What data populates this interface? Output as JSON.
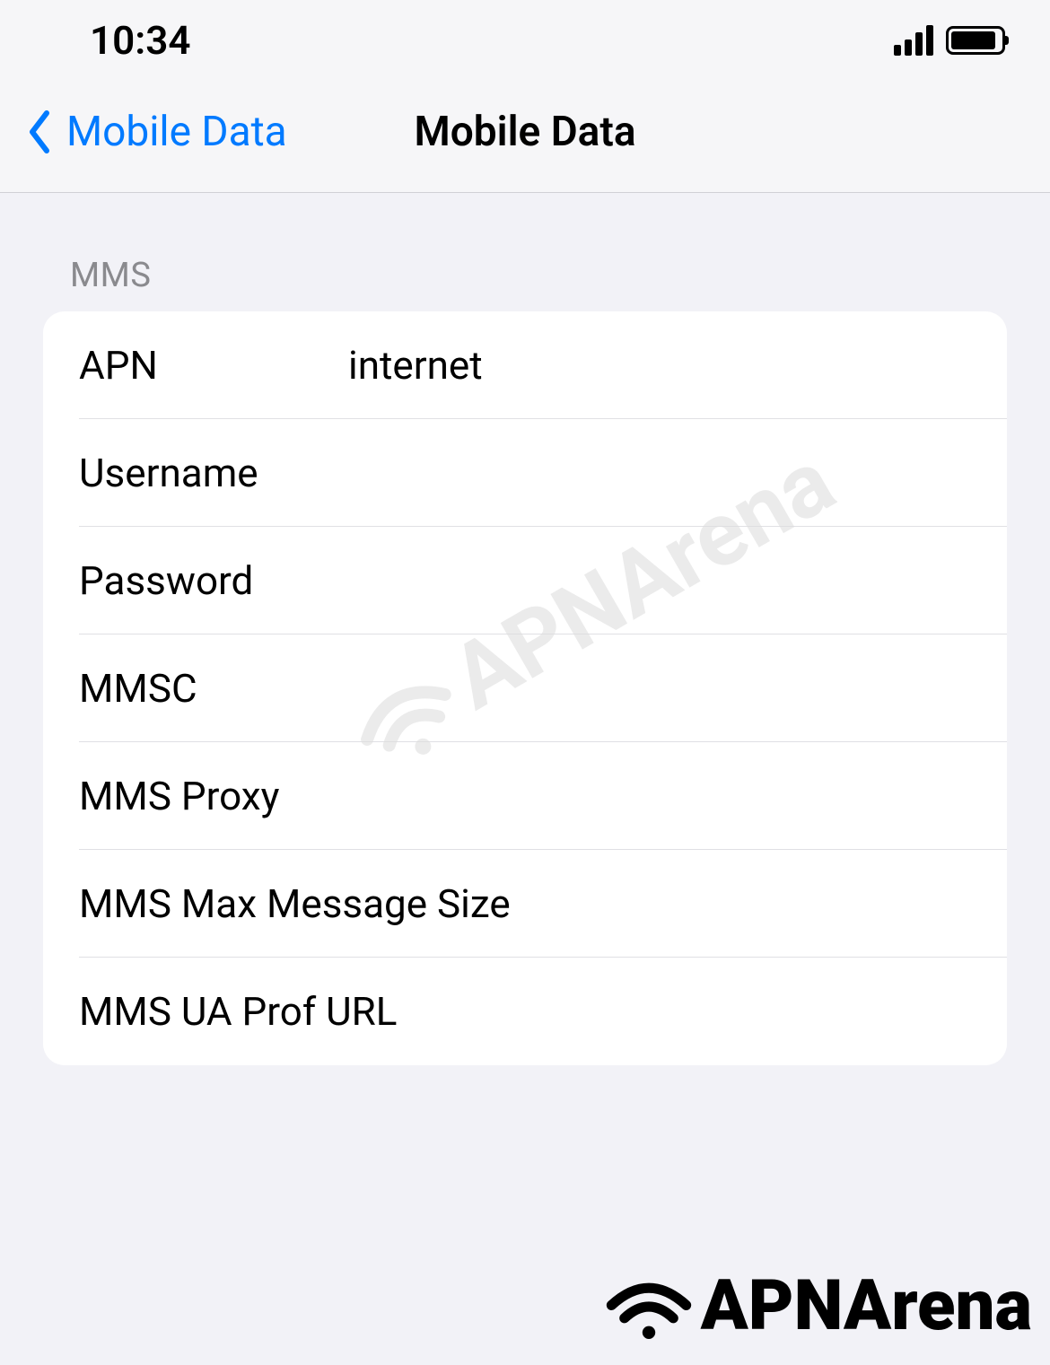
{
  "statusBar": {
    "time": "10:34"
  },
  "navBar": {
    "backLabel": "Mobile Data",
    "title": "Mobile Data"
  },
  "section": {
    "header": "MMS",
    "rows": [
      {
        "label": "APN",
        "value": "internet"
      },
      {
        "label": "Username",
        "value": ""
      },
      {
        "label": "Password",
        "value": ""
      },
      {
        "label": "MMSC",
        "value": ""
      },
      {
        "label": "MMS Proxy",
        "value": ""
      },
      {
        "label": "MMS Max Message Size",
        "value": ""
      },
      {
        "label": "MMS UA Prof URL",
        "value": ""
      }
    ]
  },
  "watermark": {
    "text": "APNArena"
  }
}
